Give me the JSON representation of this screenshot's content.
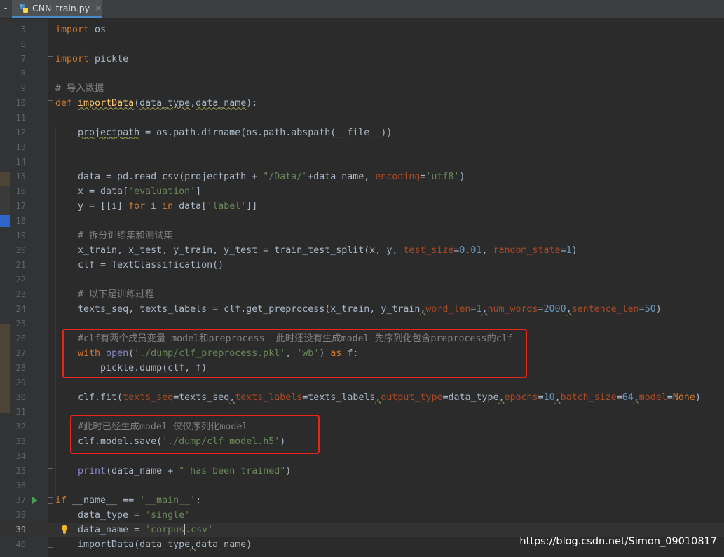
{
  "tab": {
    "title": "CNN_train.py",
    "close": "×"
  },
  "watermark": "https://blog.csdn.net/Simon_09010817",
  "lines": [
    {
      "n": 5,
      "html": "<span class=\"kw\">import</span> os"
    },
    {
      "n": 6,
      "html": ""
    },
    {
      "n": 7,
      "html": "<span class=\"kw\">import</span> pickle",
      "fold": true
    },
    {
      "n": 8,
      "html": ""
    },
    {
      "n": 9,
      "html": "<span class=\"cm\"># 导入数据</span>"
    },
    {
      "n": 10,
      "html": "<span class=\"kw\">def</span> <span class=\"fn warn\">importData</span>(<span class=\"warn\">data_type</span>,<span class=\"warn\">data_name</span>):",
      "fold": true
    },
    {
      "n": 11,
      "html": ""
    },
    {
      "n": 12,
      "html": "    <span class=\"warn\">projectpath</span> = os.path.dirname(os.path.abspath(__file__))"
    },
    {
      "n": 13,
      "html": ""
    },
    {
      "n": 14,
      "html": ""
    },
    {
      "n": 15,
      "html": "    data = pd.read_csv(projectpath + <span class=\"str\">\"/Data/\"</span>+data_name, <span class=\"kwarg\">encoding</span>=<span class=\"str\">'utf8'</span>)"
    },
    {
      "n": 16,
      "html": "    x = data[<span class=\"str\">'evaluation'</span>]"
    },
    {
      "n": 17,
      "html": "    y = [[i] <span class=\"kw\">for</span> i <span class=\"kw\">in</span> data[<span class=\"str\">'label'</span>]]"
    },
    {
      "n": 18,
      "html": ""
    },
    {
      "n": 19,
      "html": "    <span class=\"cm\"># 拆分训练集和测试集</span>"
    },
    {
      "n": 20,
      "html": "    x_train, x_test, y_train, y_test = train_test_split(x, y, <span class=\"kwarg\">test_size</span>=<span class=\"num\">0.01</span>, <span class=\"kwarg\">random_state</span>=<span class=\"num\">1</span>)"
    },
    {
      "n": 21,
      "html": "    clf = TextClassification()"
    },
    {
      "n": 22,
      "html": ""
    },
    {
      "n": 23,
      "html": "    <span class=\"cm\"># 以下是训练过程</span>"
    },
    {
      "n": 24,
      "html": "    texts_seq, texts_labels = clf.get_preprocess(x_train, y_train<span class=\"warn\">,</span><span class=\"kwarg\">word_len</span>=<span class=\"num\">1</span><span class=\"warn\">,</span><span class=\"kwarg\">num_words</span>=<span class=\"num\">2000</span><span class=\"warn\">,</span><span class=\"kwarg\">sentence_len</span>=<span class=\"num\">50</span>)"
    },
    {
      "n": 25,
      "html": ""
    },
    {
      "n": 26,
      "html": "    <span class=\"cm\">#clf有两个成员变量 model和preprocess  此时还没有生成model 先序列化包含preprocess的clf</span>"
    },
    {
      "n": 27,
      "html": "    <span class=\"kw\">with</span> <span class=\"bi\">open</span>(<span class=\"str\">'./dump/clf_preprocess.pkl'</span>, <span class=\"str\">'wb'</span>) <span class=\"kw\">as</span> f:"
    },
    {
      "n": 28,
      "html": "        pickle.dump(clf, f)"
    },
    {
      "n": 29,
      "html": ""
    },
    {
      "n": 30,
      "html": "    clf.fit(<span class=\"kwarg\">texts_seq</span>=texts_seq<span class=\"warn\">,</span><span class=\"kwarg\">texts_labels</span>=texts_labels<span class=\"warn\">,</span><span class=\"kwarg\">output_type</span>=data_type<span class=\"warn\">,</span><span class=\"kwarg\">epochs</span>=<span class=\"num\">10</span><span class=\"warn\">,</span><span class=\"kwarg\">batch_size</span>=<span class=\"num\">64</span><span class=\"warn\">,</span><span class=\"kwarg\">model</span>=<span class=\"kw\">None</span>)"
    },
    {
      "n": 31,
      "html": ""
    },
    {
      "n": 32,
      "html": "    <span class=\"cm\">#此时已经生成model 仅仅序列化model</span>"
    },
    {
      "n": 33,
      "html": "    clf.model.save(<span class=\"str\">'./dump/clf_model.h5'</span>)"
    },
    {
      "n": 34,
      "html": ""
    },
    {
      "n": 35,
      "html": "    <span class=\"bi\">print</span>(data_name + <span class=\"str\">\" has been trained\"</span>)",
      "fold": true
    },
    {
      "n": 36,
      "html": ""
    },
    {
      "n": 37,
      "html": "<span class=\"kw\">if</span> __name__ == <span class=\"str\">'__main__'</span>:",
      "fold": true,
      "run": true
    },
    {
      "n": 38,
      "html": "    data_type = <span class=\"str\">'single'</span>"
    },
    {
      "n": 39,
      "html": "    data_name = <span class=\"str\">'corpus<span class=\"caret\"></span>.csv'</span>",
      "current": true,
      "bulb": true
    },
    {
      "n": 40,
      "html": "    importData(data_type<span class=\"warn\">,</span>data_name)",
      "fold": true
    }
  ]
}
